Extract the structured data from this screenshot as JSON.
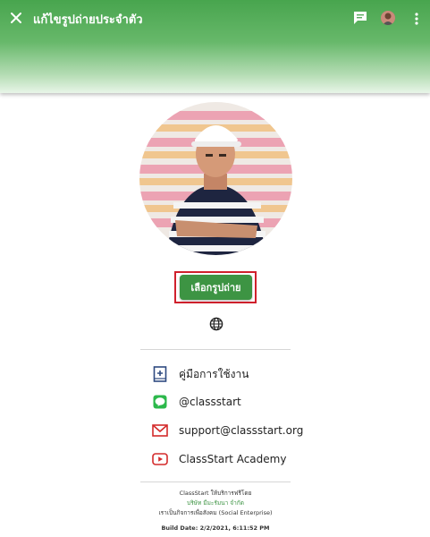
{
  "header": {
    "title": "แก้ไขรูปถ่ายประจำตัว",
    "accent_color": "#48a54e"
  },
  "choose_button": {
    "label": "เลือกรูปถ่าย"
  },
  "links": [
    {
      "label": "คู่มือการใช้งาน",
      "icon": "book-plus-icon"
    },
    {
      "label": "@classstart",
      "icon": "line-icon"
    },
    {
      "label": "support@classstart.org",
      "icon": "mail-icon"
    },
    {
      "label": "ClassStart Academy",
      "icon": "youtube-icon"
    }
  ],
  "footer": {
    "line1_prefix": "ClassStart",
    "line1_suffix": " ให้บริการฟรีโดย",
    "line2": "บริษัท มีมะรัมนา จำกัด",
    "line3": "เราเป็นกิจการเพื่อสังคม (Social Enterprise)",
    "build": "Build Date: 2/2/2021, 6:11:52 PM"
  }
}
